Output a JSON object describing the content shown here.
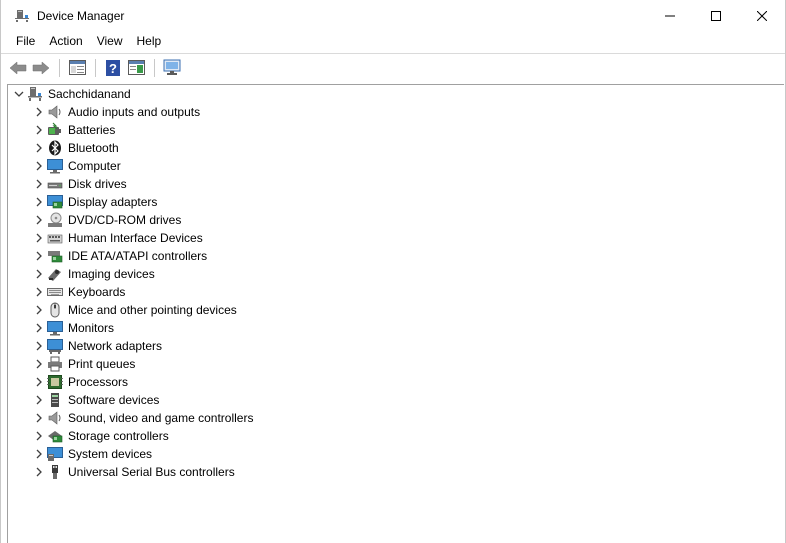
{
  "window": {
    "title": "Device Manager",
    "buttons": {
      "minimize": "minimize",
      "maximize": "maximize",
      "close": "close"
    }
  },
  "menu": [
    "File",
    "Action",
    "View",
    "Help"
  ],
  "toolbar": {
    "buttons": [
      "back-arrow-icon",
      "forward-arrow-icon",
      "properties-pane-icon",
      "help-icon",
      "show-hide-console-tree-icon",
      "scan-hardware-icon"
    ]
  },
  "tree": {
    "root": {
      "label": "Sachchidanand",
      "icon": "computer-tower-icon",
      "expanded": true
    },
    "categories": [
      {
        "label": "Audio inputs and outputs",
        "icon": "speaker-icon"
      },
      {
        "label": "Batteries",
        "icon": "battery-icon"
      },
      {
        "label": "Bluetooth",
        "icon": "bluetooth-icon"
      },
      {
        "label": "Computer",
        "icon": "monitor-icon"
      },
      {
        "label": "Disk drives",
        "icon": "disk-drive-icon"
      },
      {
        "label": "Display adapters",
        "icon": "display-adapter-icon"
      },
      {
        "label": "DVD/CD-ROM drives",
        "icon": "dvd-drive-icon"
      },
      {
        "label": "Human Interface Devices",
        "icon": "hid-icon"
      },
      {
        "label": "IDE ATA/ATAPI controllers",
        "icon": "ide-controller-icon"
      },
      {
        "label": "Imaging devices",
        "icon": "camera-icon"
      },
      {
        "label": "Keyboards",
        "icon": "keyboard-icon"
      },
      {
        "label": "Mice and other pointing devices",
        "icon": "mouse-icon"
      },
      {
        "label": "Monitors",
        "icon": "monitor-icon"
      },
      {
        "label": "Network adapters",
        "icon": "network-adapter-icon"
      },
      {
        "label": "Print queues",
        "icon": "printer-icon"
      },
      {
        "label": "Processors",
        "icon": "processor-icon"
      },
      {
        "label": "Software devices",
        "icon": "software-device-icon"
      },
      {
        "label": "Sound, video and game controllers",
        "icon": "sound-controller-icon"
      },
      {
        "label": "Storage controllers",
        "icon": "storage-controller-icon"
      },
      {
        "label": "System devices",
        "icon": "system-device-icon"
      },
      {
        "label": "Universal Serial Bus controllers",
        "icon": "usb-icon"
      }
    ]
  },
  "colors": {
    "accent": "#1e73be",
    "separator": "#dadada"
  }
}
